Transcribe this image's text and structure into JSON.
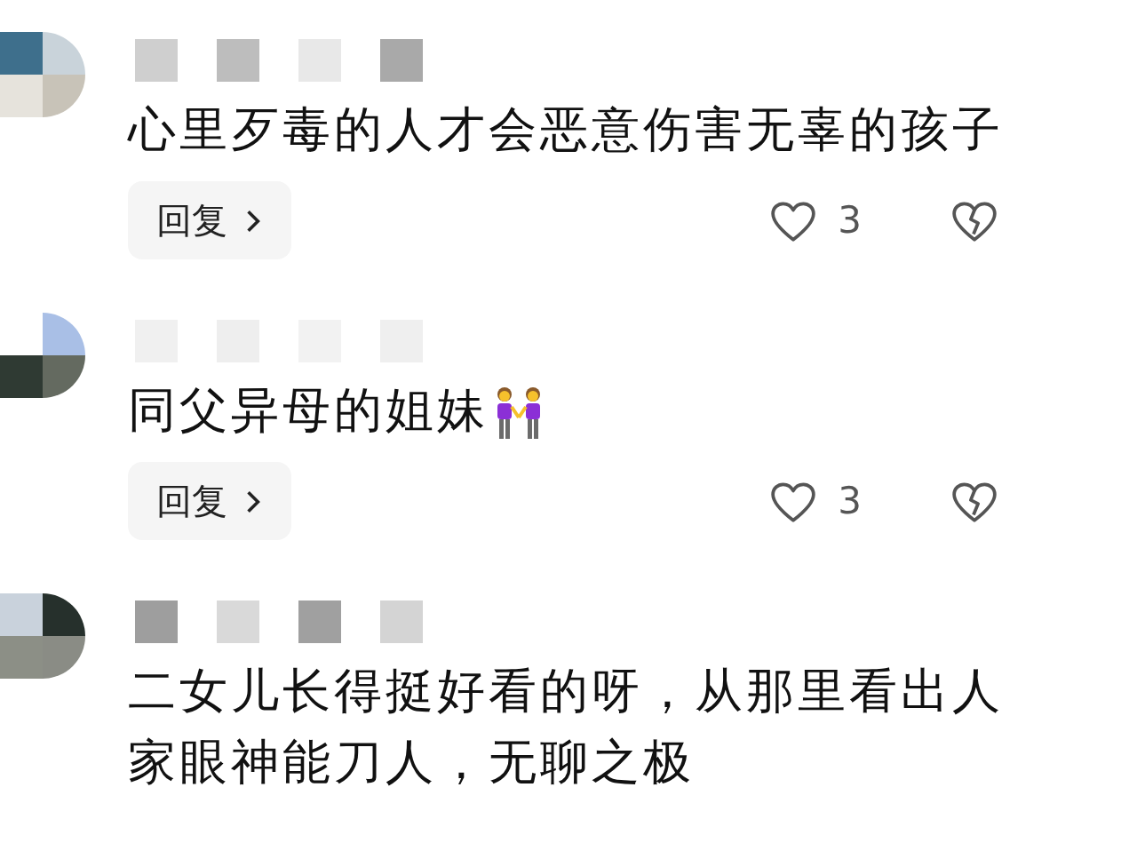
{
  "comments": [
    {
      "kind": "plain",
      "text": "心里歹毒的人才会恶意伤害无辜的孩子",
      "reply": "回复",
      "likes": "3"
    },
    {
      "kind": "with-emoji",
      "text": "同父异母的姐妹",
      "reply": "回复",
      "likes": "3"
    },
    {
      "kind": "plain",
      "text": "二女儿长得挺好看的呀，从那里看出人家眼神能刀人，无聊之极"
    }
  ]
}
